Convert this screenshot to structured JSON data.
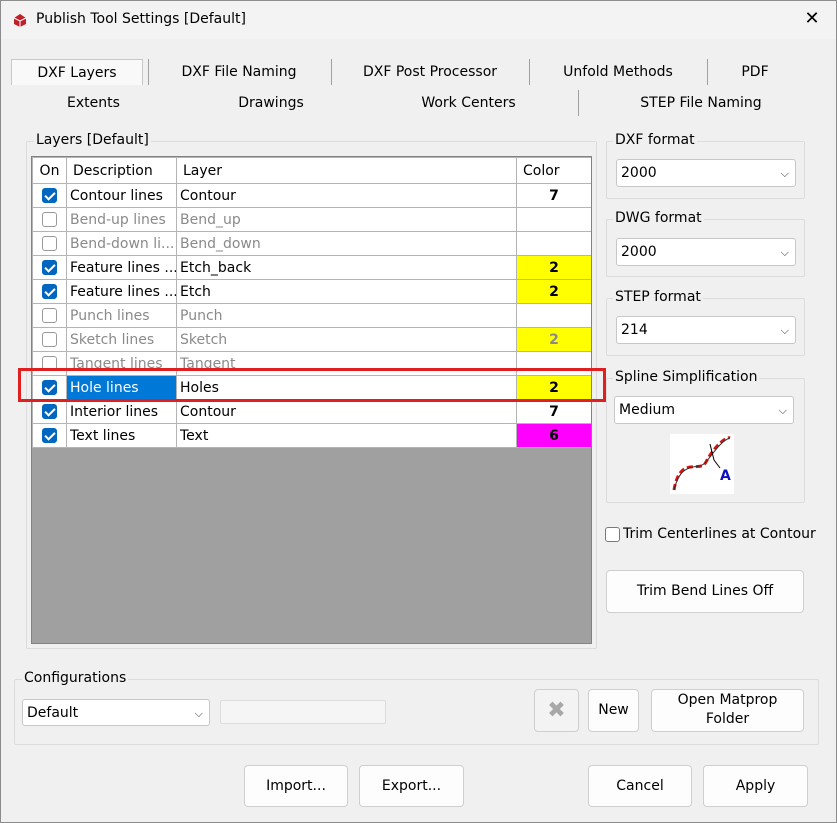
{
  "window": {
    "title": "Publish Tool Settings  [Default]"
  },
  "tabs": {
    "row1": [
      "DXF Layers",
      "DXF File Naming",
      "DXF Post Processor",
      "Unfold Methods",
      "PDF"
    ],
    "row2": [
      "Extents",
      "Drawings",
      "Work Centers",
      "STEP File Naming"
    ]
  },
  "layers": {
    "group_title": "Layers [Default]",
    "headers": {
      "on": "On",
      "description": "Description",
      "layer": "Layer",
      "color": "Color"
    },
    "rows": [
      {
        "on": true,
        "description": "Contour lines",
        "layer": "Contour",
        "color": "7"
      },
      {
        "on": false,
        "description": "Bend-up lines",
        "layer": "Bend_up",
        "color": ""
      },
      {
        "on": false,
        "description": "Bend-down li...",
        "layer": "Bend_down",
        "color": ""
      },
      {
        "on": true,
        "description": "Feature lines ...",
        "layer": "Etch_back",
        "color": "2"
      },
      {
        "on": true,
        "description": "Feature lines ...",
        "layer": "Etch",
        "color": "2"
      },
      {
        "on": false,
        "description": "Punch lines",
        "layer": "Punch",
        "color": ""
      },
      {
        "on": false,
        "description": "Sketch lines",
        "layer": "Sketch",
        "color": "2"
      },
      {
        "on": false,
        "description": "Tangent lines",
        "layer": "Tangent",
        "color": ""
      },
      {
        "on": true,
        "description": "Hole lines",
        "layer": "Holes",
        "color": "2"
      },
      {
        "on": true,
        "description": "Interior lines",
        "layer": "Contour",
        "color": "7"
      },
      {
        "on": true,
        "description": "Text lines",
        "layer": "Text",
        "color": "6"
      }
    ],
    "row_colors": [
      "#ffffff",
      "#ffffff",
      "#ffffff",
      "#ffff00",
      "#ffff00",
      "#ffffff",
      "#ffff00",
      "#ffffff",
      "#ffff00",
      "#ffffff",
      "#ff00ff"
    ]
  },
  "dxf_format": {
    "label": "DXF format",
    "value": "2000"
  },
  "dwg_format": {
    "label": "DWG format",
    "value": "2000"
  },
  "step_format": {
    "label": "STEP format",
    "value": "214"
  },
  "spline": {
    "label": "Spline Simplification",
    "value": "Medium"
  },
  "trim_centerlines": {
    "label": "Trim Centerlines at Contour",
    "checked": false
  },
  "trim_bend_button": "Trim Bend Lines Off",
  "configurations": {
    "label": "Configurations",
    "value": "Default"
  },
  "buttons": {
    "new": "New",
    "open_matprop_line1": "Open Matprop",
    "open_matprop_line2": "Folder",
    "import": "Import...",
    "export": "Export...",
    "cancel": "Cancel",
    "apply": "Apply"
  },
  "colors": {
    "selection": "#0078d7",
    "highlight": "#e02020",
    "checkbox": "#0067c0"
  }
}
